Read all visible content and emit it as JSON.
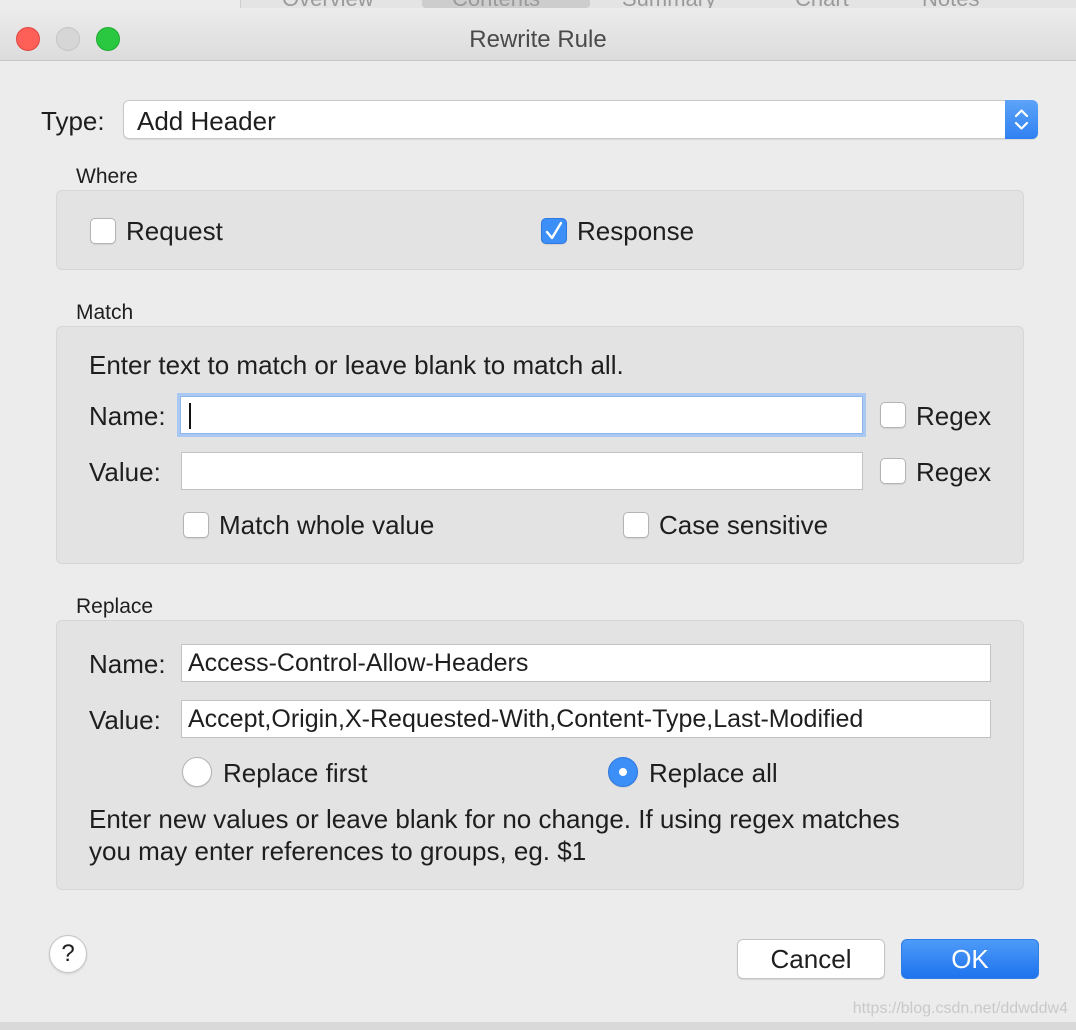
{
  "background_window": {
    "tabs": [
      "Overview",
      "Contents",
      "Summary",
      "Chart",
      "Notes"
    ]
  },
  "window": {
    "title": "Rewrite Rule"
  },
  "type": {
    "label": "Type:",
    "value": "Add Header"
  },
  "where": {
    "label": "Where",
    "request_label": "Request",
    "request_checked": false,
    "response_label": "Response",
    "response_checked": true
  },
  "match": {
    "label": "Match",
    "hint": "Enter text to match or leave blank to match all.",
    "name_label": "Name:",
    "name_value": "",
    "value_label": "Value:",
    "value_value": "",
    "name_regex_label": "Regex",
    "value_regex_label": "Regex",
    "match_whole_label": "Match whole value",
    "case_sensitive_label": "Case sensitive"
  },
  "replace": {
    "label": "Replace",
    "name_label": "Name:",
    "name_value": "Access-Control-Allow-Headers",
    "value_label": "Value:",
    "value_value": "Accept,Origin,X-Requested-With,Content-Type,Last-Modified",
    "replace_first_label": "Replace first",
    "replace_all_label": "Replace all",
    "selected": "Replace all",
    "hint_line1": "Enter new values or leave blank for no change. If using regex matches",
    "hint_line2": "you may enter references to groups, eg. $1"
  },
  "buttons": {
    "help": "?",
    "cancel": "Cancel",
    "ok": "OK"
  },
  "watermark": "https://blog.csdn.net/ddwddw4",
  "colors": {
    "accent": "#3b8ff6",
    "close": "#fe5f57",
    "maximize": "#2ac840"
  }
}
